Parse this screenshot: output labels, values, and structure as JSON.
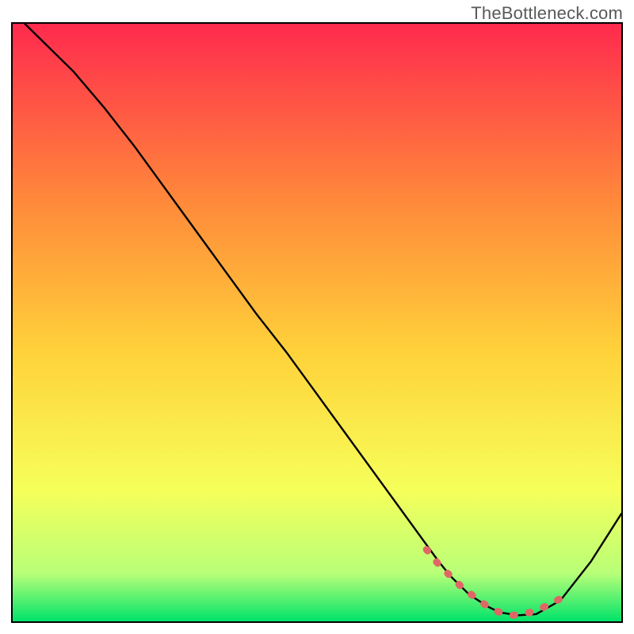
{
  "watermark": "TheBottleneck.com",
  "chart_data": {
    "type": "line",
    "title": "",
    "xlabel": "",
    "ylabel": "",
    "xlim": [
      0,
      100
    ],
    "ylim": [
      0,
      100
    ],
    "grid": false,
    "legend": false,
    "background_gradient": {
      "top": "#ff2a4e",
      "upper_mid": "#ff8a3a",
      "mid": "#ffd23a",
      "lower_mid": "#f6ff5a",
      "near_bottom": "#b8ff78",
      "bottom": "#00e36a"
    },
    "series": [
      {
        "name": "curve",
        "type": "line",
        "color": "#000000",
        "x": [
          2,
          5,
          10,
          15,
          20,
          25,
          30,
          35,
          40,
          45,
          50,
          55,
          60,
          65,
          70,
          72,
          75,
          78,
          80,
          83,
          86,
          90,
          95,
          100
        ],
        "y": [
          100,
          97,
          92,
          86,
          79.5,
          72.5,
          65.5,
          58.5,
          51.5,
          45,
          38,
          31,
          24,
          17,
          10,
          7.5,
          4.5,
          2.5,
          1.5,
          1.0,
          1.2,
          3.5,
          10,
          18
        ]
      },
      {
        "name": "trough-highlight",
        "type": "line",
        "color": "#e06666",
        "style": "dashed-thick",
        "x": [
          68,
          70,
          72,
          74,
          76,
          78,
          80,
          82,
          84,
          86,
          88,
          90
        ],
        "y": [
          12,
          9.5,
          7.5,
          5.5,
          4.0,
          2.5,
          1.5,
          1.0,
          1.2,
          1.8,
          2.7,
          3.8
        ]
      }
    ]
  }
}
